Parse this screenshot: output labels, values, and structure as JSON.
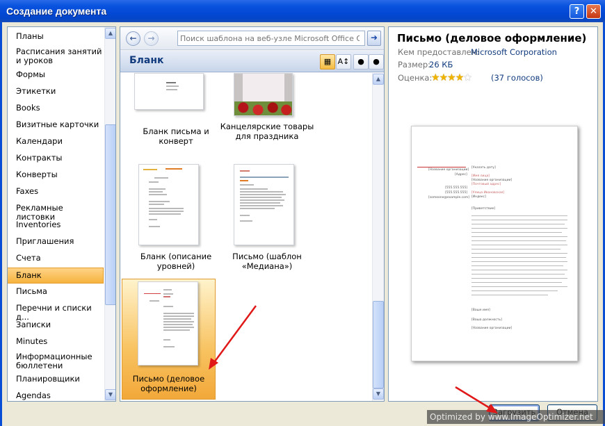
{
  "window": {
    "title": "Создание документа",
    "help_glyph": "?",
    "close_glyph": "✕"
  },
  "left_pane": {
    "items": [
      {
        "label": "Планы"
      },
      {
        "label": "Расписания занятий и уроков"
      },
      {
        "label": "Формы"
      },
      {
        "label": "Этикетки"
      },
      {
        "label": "Books"
      },
      {
        "label": "Визитные карточки"
      },
      {
        "label": "Календари"
      },
      {
        "label": "Контракты"
      },
      {
        "label": "Конверты"
      },
      {
        "label": "Faxes"
      },
      {
        "label": "Рекламные листовки"
      },
      {
        "label": "Inventories"
      },
      {
        "label": "Приглашения"
      },
      {
        "label": "Счета"
      },
      {
        "label": "Бланк",
        "selected": true
      },
      {
        "label": "Письма"
      },
      {
        "label": "Перечни и списки д..."
      },
      {
        "label": "Записки"
      },
      {
        "label": "Minutes"
      },
      {
        "label": "Информационные бюллетени"
      },
      {
        "label": "Планировщики"
      },
      {
        "label": "Agendas"
      }
    ]
  },
  "middle_pane": {
    "search_placeholder": "Поиск шаблона на веб-узле Microsoft Office Online",
    "section_title": "Бланк",
    "templates": [
      {
        "name": "Бланк письма и конверт"
      },
      {
        "name": "Канцелярские товары для праздника"
      },
      {
        "name": "Бланк (описание уровней)"
      },
      {
        "name": "Письмо (шаблон «Медиана»)"
      },
      {
        "name": "Письмо (деловое оформление)",
        "selected": true
      }
    ]
  },
  "details": {
    "title": "Письмо (деловое оформление)",
    "provider_label": "Кем предоставлен:",
    "provider": "Microsoft Corporation",
    "size_label": "Размер:",
    "size": "26 КБ",
    "rating_label": "Оценка:",
    "rating_stars": 4,
    "rating_max": 5,
    "votes": "(37 голосов)"
  },
  "buttons": {
    "create": "Загрузить",
    "cancel": "Отмена"
  },
  "watermark": "Optimized by www.ImageOptimizer.net",
  "colors": {
    "accent_red": "#e02020",
    "selection": "#f6b33e",
    "titlebar": "#0a54e0"
  }
}
